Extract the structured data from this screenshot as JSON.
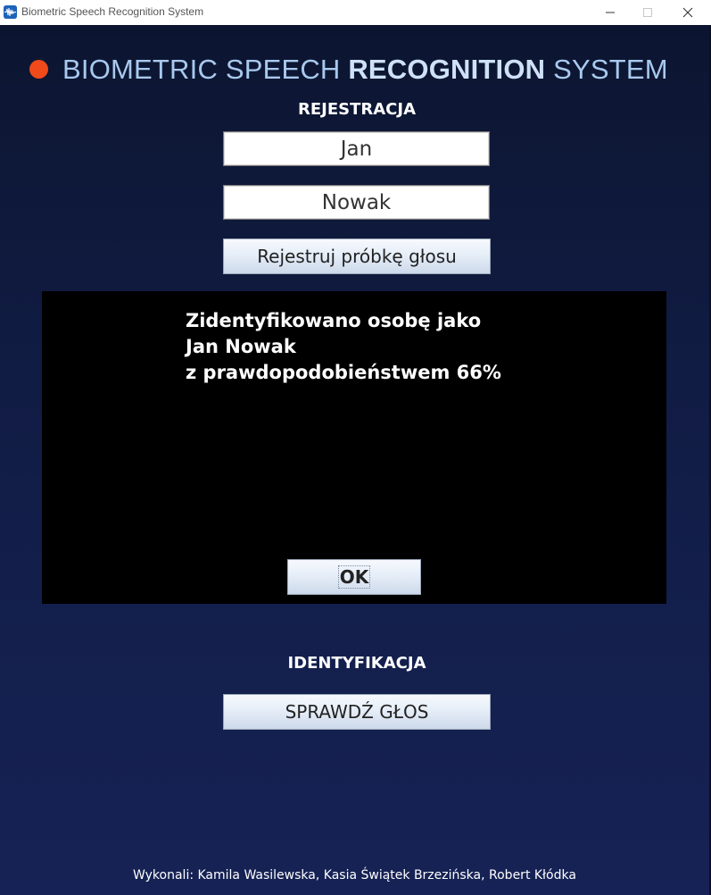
{
  "window": {
    "title": "Biometric Speech Recognition System",
    "icon": "waveform-icon",
    "controls": [
      "minimize-icon",
      "maximize-icon",
      "close-icon"
    ]
  },
  "header": {
    "title_part1": "BIOMETRIC SPEECH ",
    "title_bold": "RECOGNITION",
    "title_part3": " SYSTEM",
    "indicator_color": "#f04a1a"
  },
  "registration": {
    "label": "REJESTRACJA",
    "first_name": "Jan",
    "last_name": "Nowak",
    "register_button": "Rejestruj próbkę głosu"
  },
  "result_dialog": {
    "line1": "Zidentyfikowano osobę jako",
    "line2": "Jan Nowak",
    "line3": "z prawdopodobieństwem 66%",
    "ok_button": "OK"
  },
  "identification": {
    "label": "IDENTYFIKACJA",
    "check_button": "SPRAWDŹ GŁOS"
  },
  "footer": {
    "credits": "Wykonali: Kamila Wasilewska, Kasia Świątek Brzezińska, Robert Kłódka"
  },
  "colors": {
    "background_top": "#0c1530",
    "background_bottom": "#162255",
    "heading": "#a9c9ee"
  }
}
